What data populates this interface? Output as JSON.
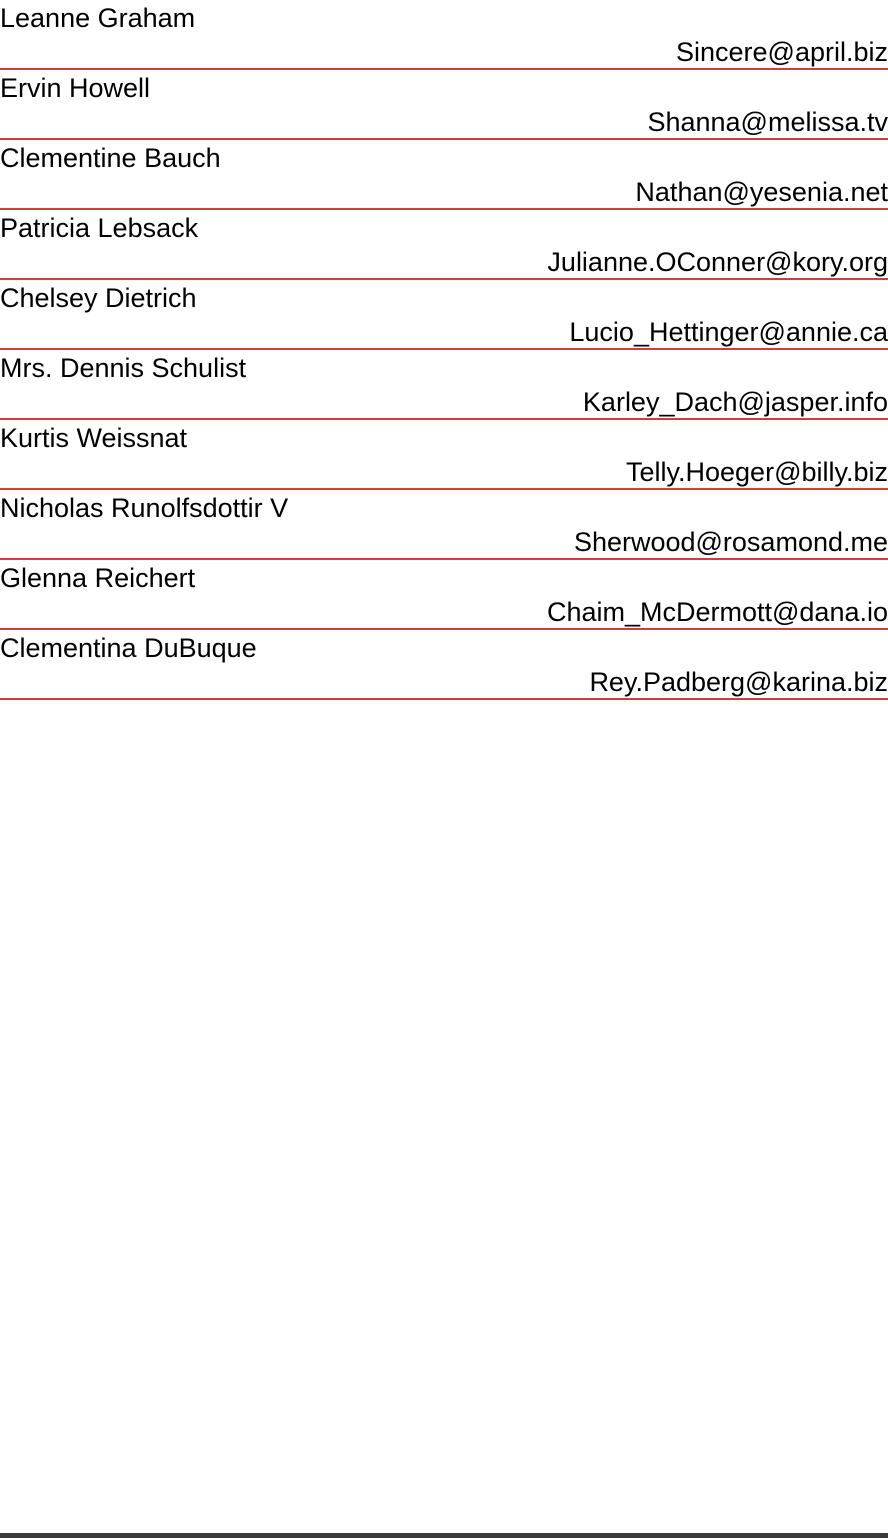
{
  "colors": {
    "row_divider": "#d23c3c",
    "text": "#000000",
    "background": "#ffffff",
    "bottom_bar": "#3a3a3a"
  },
  "users": [
    {
      "name": "Leanne Graham",
      "email": "Sincere@april.biz"
    },
    {
      "name": "Ervin Howell",
      "email": "Shanna@melissa.tv"
    },
    {
      "name": "Clementine Bauch",
      "email": "Nathan@yesenia.net"
    },
    {
      "name": "Patricia Lebsack",
      "email": "Julianne.OConner@kory.org"
    },
    {
      "name": "Chelsey Dietrich",
      "email": "Lucio_Hettinger@annie.ca"
    },
    {
      "name": "Mrs. Dennis Schulist",
      "email": "Karley_Dach@jasper.info"
    },
    {
      "name": "Kurtis Weissnat",
      "email": "Telly.Hoeger@billy.biz"
    },
    {
      "name": "Nicholas Runolfsdottir V",
      "email": "Sherwood@rosamond.me"
    },
    {
      "name": "Glenna Reichert",
      "email": "Chaim_McDermott@dana.io"
    },
    {
      "name": "Clementina DuBuque",
      "email": "Rey.Padberg@karina.biz"
    }
  ]
}
